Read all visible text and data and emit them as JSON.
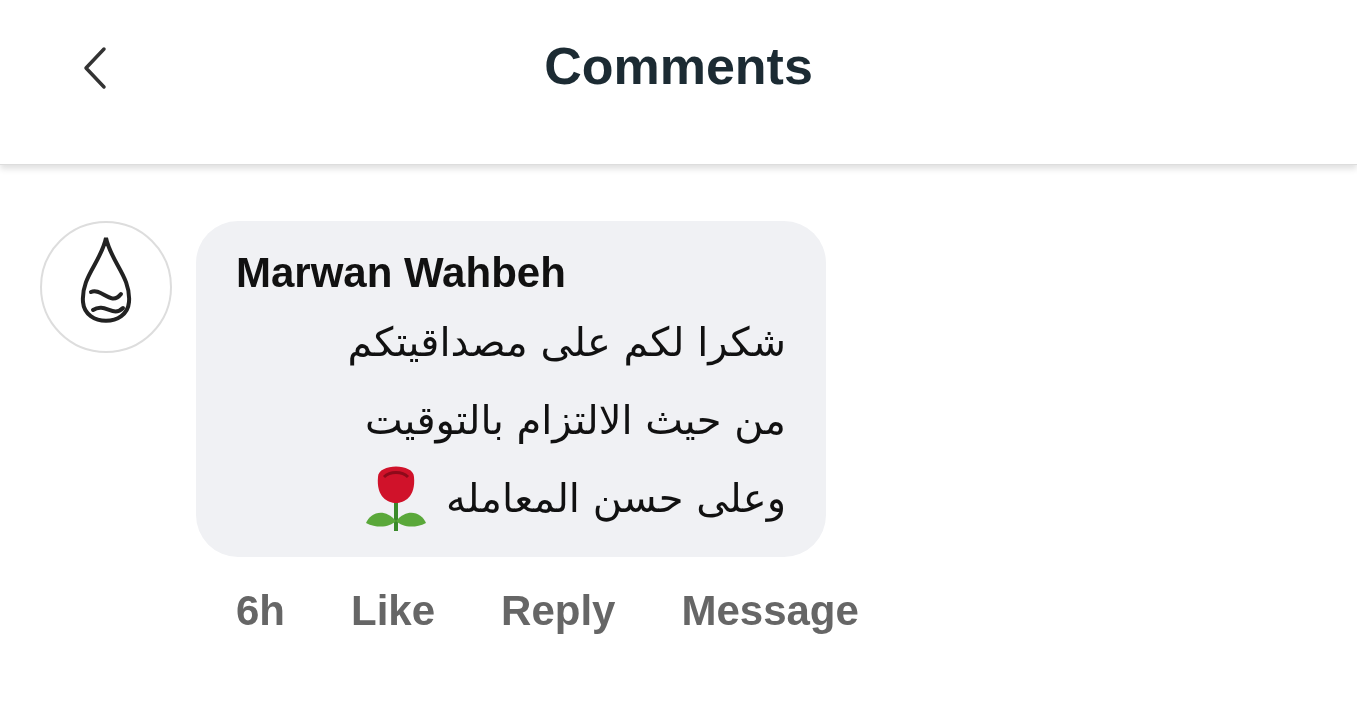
{
  "header": {
    "title": "Comments"
  },
  "comment": {
    "author": "Marwan Wahbeh",
    "lines": [
      "شكرا لكم على مصداقيتكم",
      "من حيث الالتزام بالتوقيت",
      "وعلى حسن المعامله"
    ],
    "time": "6h",
    "like": "Like",
    "reply": "Reply",
    "message": "Message"
  }
}
